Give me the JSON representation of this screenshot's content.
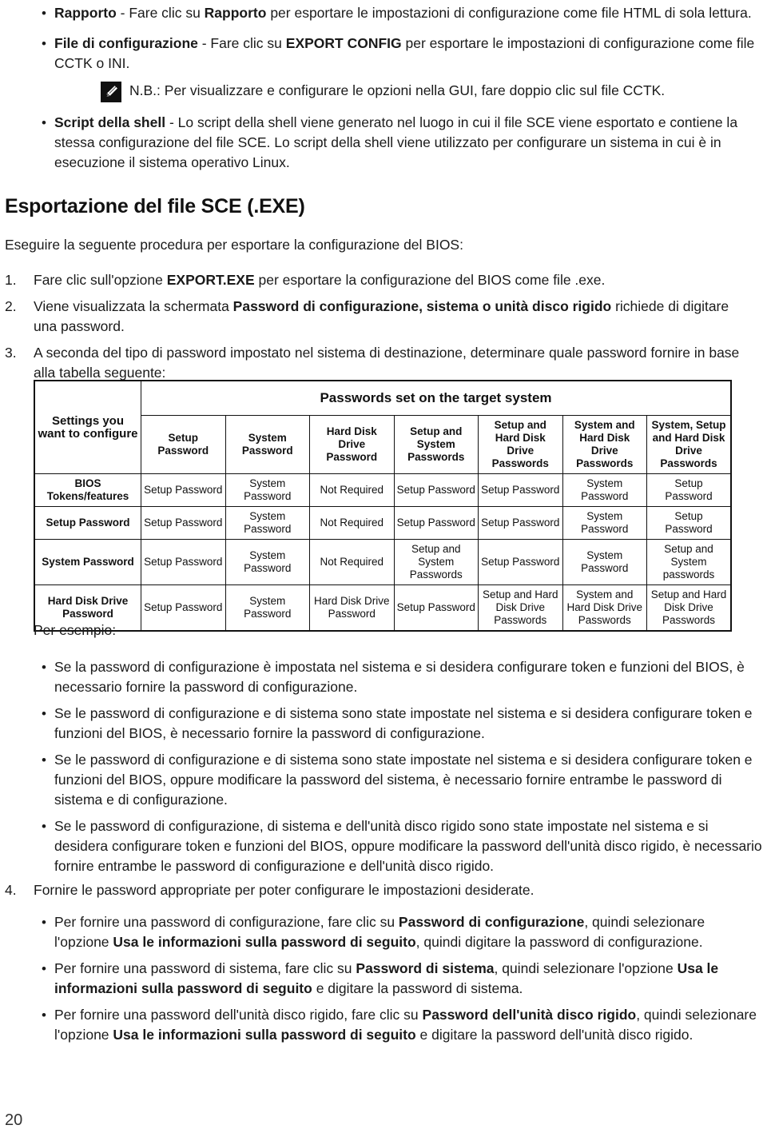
{
  "page": {
    "number": "20"
  },
  "top_bullets": [
    {
      "lead": "Rapporto",
      "rest_before_bold": " - Fare clic su ",
      "bold2": "Rapporto",
      "rest": " per esportare le impostazioni di configurazione come file HTML di sola lettura."
    },
    {
      "lead": "File di configurazione",
      "rest_before_bold": " - Fare clic su ",
      "bold2": "EXPORT CONFIG",
      "rest": " per esportare le impostazioni di configurazione come file CCTK o INI."
    }
  ],
  "note": {
    "icon": "note-pencil-icon",
    "label": "N.B.:",
    "text": " Per visualizzare e configurare le opzioni nella GUI, fare doppio clic sul file CCTK."
  },
  "shell_bullet": {
    "lead": "Script della shell",
    "rest": " - Lo script della shell viene generato nel luogo in cui il file SCE viene esportato e contiene la stessa configurazione del file SCE. Lo script della shell viene utilizzato per configurare un sistema in cui è in esecuzione il sistema operativo Linux."
  },
  "section": {
    "title": "Esportazione del file SCE (.EXE)",
    "intro": "Eseguire la seguente procedura per esportare la configurazione del BIOS:"
  },
  "steps": [
    {
      "marker": "1.",
      "pre": "Fare clic sull'opzione ",
      "bold": "EXPORT.EXE",
      "post": " per esportare la configurazione del BIOS come file .exe."
    },
    {
      "marker": "2.",
      "pre": "Viene visualizzata la schermata ",
      "bold": "Password di configurazione, sistema o unità disco rigido",
      "post": " richiede di digitare una password."
    },
    {
      "marker": "3.",
      "pre": "A seconda del tipo di password impostato nel sistema di destinazione, determinare quale password fornire in base alla tabella seguente:",
      "bold": "",
      "post": ""
    }
  ],
  "step4": {
    "marker": "4.",
    "text": "Fornire le password appropriate per poter configurare le impostazioni desiderate."
  },
  "table": {
    "corner_label": "Settings you want to configure",
    "banner": "Passwords set on the target system",
    "columns": [
      "Setup Password",
      "System Password",
      "Hard Disk Drive Password",
      "Setup and System Passwords",
      "Setup and Hard Disk Drive Passwords",
      "System and Hard Disk Drive Passwords",
      "System, Setup and Hard Disk Drive Passwords"
    ],
    "rows": [
      {
        "label": "BIOS Tokens/features",
        "cells": [
          "Setup Password",
          "System Password",
          "Not Required",
          "Setup Password",
          "Setup Password",
          "System Password",
          "Setup Password"
        ]
      },
      {
        "label": "Setup Password",
        "cells": [
          "Setup Password",
          "System Password",
          "Not Required",
          "Setup Password",
          "Setup Password",
          "System Password",
          "Setup Password"
        ]
      },
      {
        "label": "System Password",
        "cells": [
          "Setup Password",
          "System Password",
          "Not Required",
          "Setup and System Passwords",
          "Setup Password",
          "System Password",
          "Setup and System passwords"
        ]
      },
      {
        "label": "Hard Disk Drive Password",
        "cells": [
          "Setup Password",
          "System Password",
          "Hard Disk Drive Password",
          "Setup Password",
          "Setup and Hard Disk Drive Passwords",
          "System and Hard Disk Drive Passwords",
          "Setup and Hard Disk Drive Passwords"
        ]
      }
    ]
  },
  "example_label": "Per esempio:",
  "example_bullets": [
    "Se la password di configurazione è impostata nel sistema e si desidera configurare token e funzioni del BIOS, è necessario fornire la password di configurazione.",
    "Se le password di configurazione e di sistema sono state impostate nel sistema e si desidera configurare token e funzioni del BIOS, è necessario fornire la password di configurazione.",
    "Se le password di configurazione e di sistema sono state impostate nel sistema e si desidera configurare token e funzioni del BIOS, oppure modificare la password del sistema, è necessario fornire entrambe le password di sistema e di configurazione.",
    "Se le password di configurazione, di sistema e dell'unità disco rigido sono state impostate nel sistema e si desidera configurare token e funzioni del BIOS, oppure modificare la password dell'unità disco rigido, è necessario fornire entrambe le password di configurazione e dell'unità disco rigido."
  ],
  "password_bullets": [
    {
      "p1": "Per fornire una password di configurazione, fare clic su ",
      "b1": "Password di configurazione",
      "p2": ", quindi selezionare l'opzione ",
      "b2": "Usa le informazioni sulla password di seguito",
      "p3": ", quindi digitare la password di configurazione."
    },
    {
      "p1": "Per fornire una password di sistema, fare clic su ",
      "b1": "Password di sistema",
      "p2": ", quindi selezionare l'opzione ",
      "b2": "Usa le informazioni sulla password di seguito",
      "p3": " e digitare la password di sistema."
    },
    {
      "p1": "Per fornire una password dell'unità disco rigido, fare clic su ",
      "b1": "Password dell'unità disco rigido",
      "p2": ", quindi selezionare l'opzione ",
      "b2": "Usa le informazioni sulla password di seguito",
      "p3": " e digitare la password dell'unità disco rigido."
    }
  ]
}
